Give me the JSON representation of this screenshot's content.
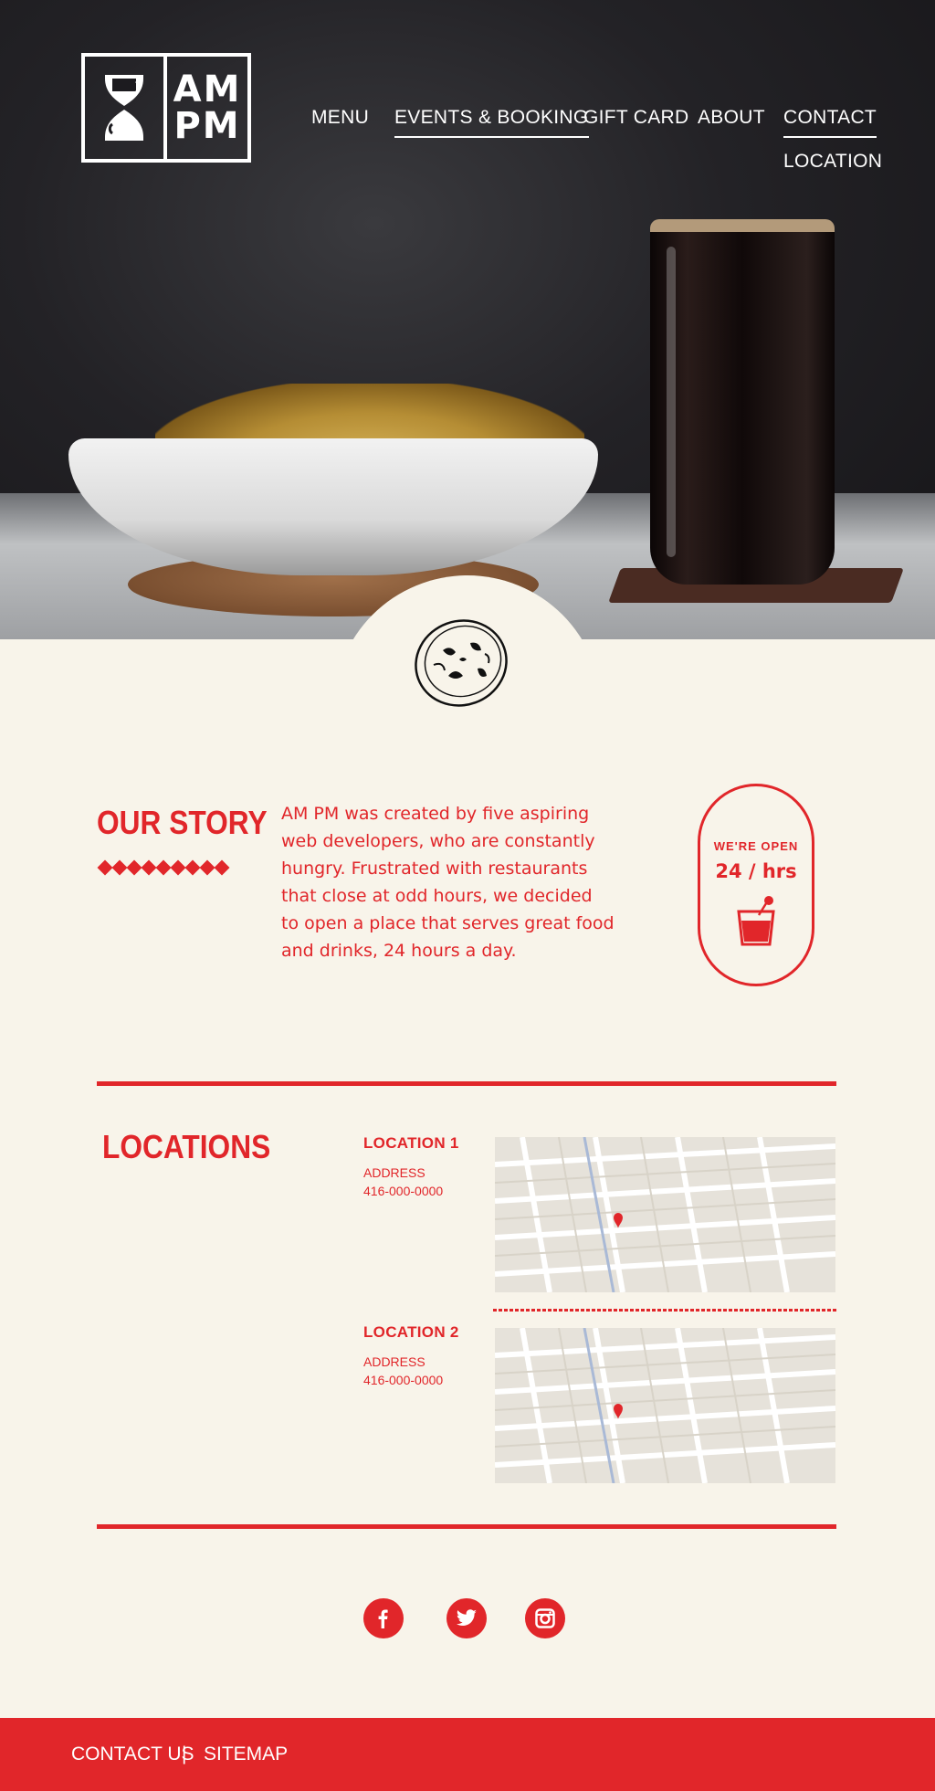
{
  "brand": {
    "logo_line1": "AM",
    "logo_line2": "PM"
  },
  "nav": {
    "menu": "MENU",
    "events": "EVENTS & BOOKING",
    "gift_card": "GIFT CARD",
    "about": "ABOUT",
    "contact": "CONTACT",
    "location": "LOCATION"
  },
  "story": {
    "title": "OUR STORY",
    "lines": [
      "AM PM was created by five aspiring",
      "web developers, who are constantly",
      "hungry. Frustrated with restaurants",
      "that close at odd hours, we decided",
      "to open a place that serves great food",
      "and drinks, 24 hours a day."
    ],
    "badge_label": "WE'RE OPEN",
    "badge_hours": "24 / hrs"
  },
  "locations": {
    "title": "LOCATIONS",
    "items": [
      {
        "name": "LOCATION 1",
        "address": "ADDRESS",
        "phone": "416-000-0000"
      },
      {
        "name": "LOCATION 2",
        "address": "ADDRESS",
        "phone": "416-000-0000"
      }
    ]
  },
  "social": [
    "facebook-icon",
    "twitter-icon",
    "instagram-icon"
  ],
  "footer": {
    "contact": "CONTACT US",
    "separator": "|",
    "sitemap": "SITEMAP"
  },
  "colors": {
    "accent": "#e1262a",
    "cream": "#f8f4ea",
    "dark": "#1c1b1f"
  }
}
